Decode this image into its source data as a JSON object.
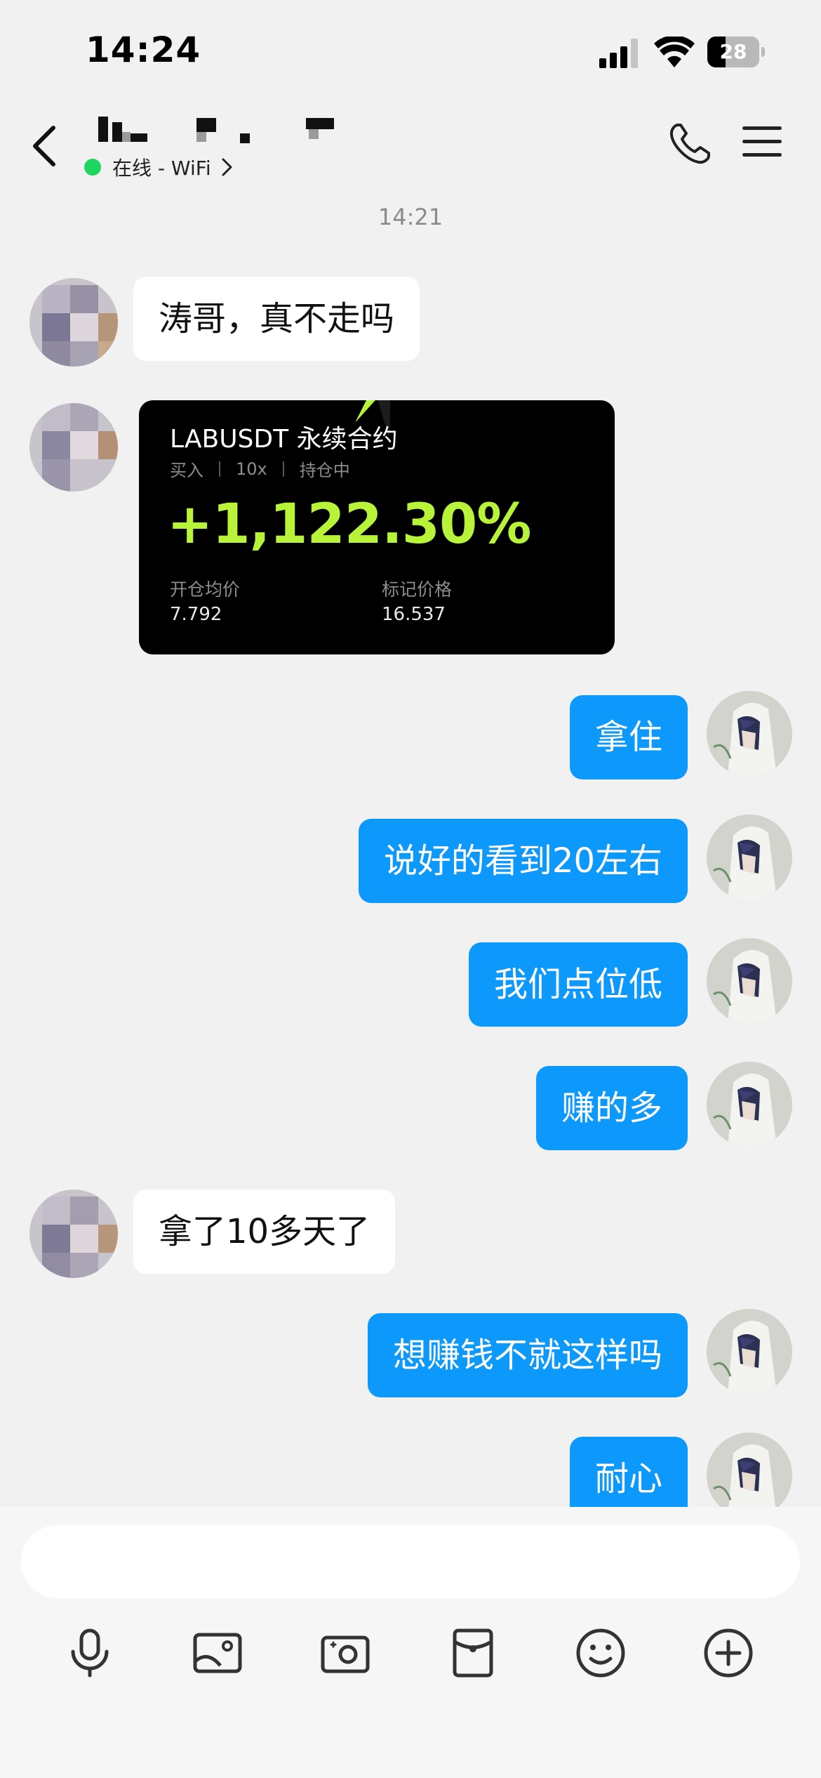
{
  "status_bar": {
    "time": "14:24",
    "battery": "28"
  },
  "header": {
    "presence": "在线 - WiFi"
  },
  "chat": {
    "timestamp": "14:21",
    "messages": [
      {
        "from": "them",
        "text": "涛哥，真不走吗"
      },
      {
        "from": "them",
        "type": "trade_card"
      },
      {
        "from": "me",
        "text": "拿住"
      },
      {
        "from": "me",
        "text": "说好的看到20左右"
      },
      {
        "from": "me",
        "text": "我们点位低"
      },
      {
        "from": "me",
        "text": "赚的多"
      },
      {
        "from": "them",
        "text": "拿了10多天了"
      },
      {
        "from": "me",
        "text": "想赚钱不就这样吗"
      },
      {
        "from": "me",
        "text": "耐心"
      }
    ],
    "trade_card": {
      "pair": "LABUSDT 永续合约",
      "side": "买入",
      "leverage": "10x",
      "status": "持仓中",
      "pnl": "+1,122.30%",
      "entry_label": "开仓均价",
      "entry_value": "7.792",
      "mark_label": "标记价格",
      "mark_value": "16.537",
      "accent_color": "#b8f33a"
    }
  },
  "toolbar": {
    "icons": [
      "microphone-icon",
      "gallery-icon",
      "camera-icon",
      "red-packet-icon",
      "emoji-icon",
      "plus-icon"
    ]
  },
  "colors": {
    "outgoing_bubble": "#0d99fb",
    "incoming_bubble": "#ffffff",
    "background": "#f1f1f1",
    "online_dot": "#1ed65f"
  }
}
